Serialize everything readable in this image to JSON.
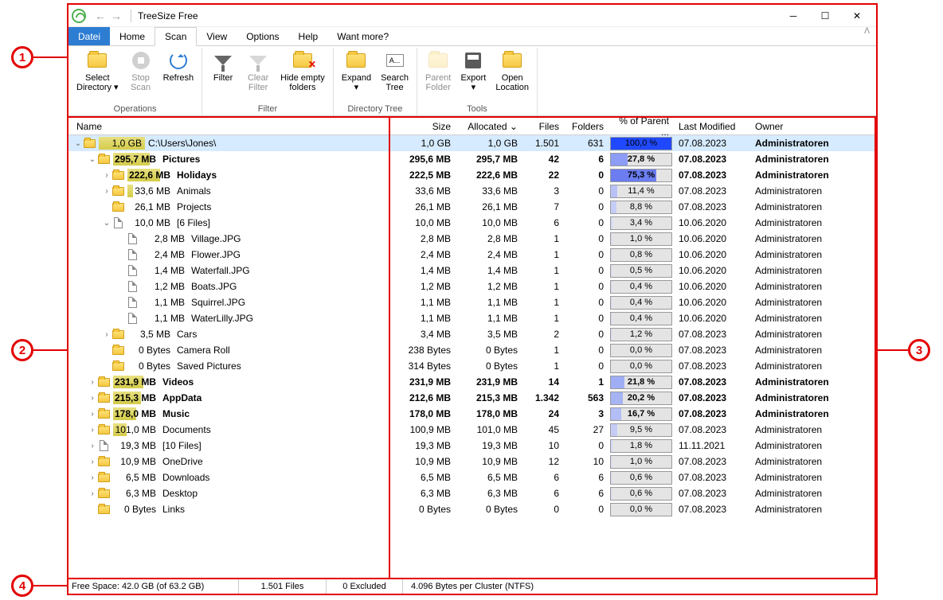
{
  "window": {
    "title": "TreeSize Free"
  },
  "menu": {
    "file": "Datei",
    "home": "Home",
    "scan": "Scan",
    "view": "View",
    "options": "Options",
    "help": "Help",
    "more": "Want more?"
  },
  "ribbon": {
    "select_dir": "Select\nDirectory ▾",
    "stop": "Stop\nScan",
    "refresh": "Refresh",
    "filter": "Filter",
    "clear_filter": "Clear\nFilter",
    "hide_empty": "Hide empty\nfolders",
    "expand": "Expand\n▾",
    "search": "Search\nTree",
    "parent": "Parent\nFolder",
    "export": "Export\n▾",
    "open_loc": "Open\nLocation",
    "grp_ops": "Operations",
    "grp_filter": "Filter",
    "grp_tree": "Directory Tree",
    "grp_tools": "Tools",
    "search_badge": "A..."
  },
  "columns": {
    "name": "Name",
    "size": "Size",
    "allocated": "Allocated ⌄",
    "files": "Files",
    "folders": "Folders",
    "percent": "% of Parent ...",
    "modified": "Last Modified",
    "owner": "Owner"
  },
  "rows": [
    {
      "depth": 0,
      "tw": "⌄",
      "icon": "folder",
      "size_label": "1,0 GB",
      "size_bar": 100,
      "name": "C:\\Users\\Jones\\",
      "bold": false,
      "selected": true,
      "size": "1,0 GB",
      "alloc": "1,0 GB",
      "files": "1.501",
      "folders": "631",
      "pct": "100,0 %",
      "pct_fill": 100,
      "pct_color": "#2049ff",
      "mod": "07.08.2023",
      "owner": "Administratoren",
      "owner_bold": true
    },
    {
      "depth": 1,
      "tw": "⌄",
      "icon": "folder",
      "size_label": "295,7 MB",
      "size_bar": 80,
      "name": "Pictures",
      "bold": true,
      "size": "295,6 MB",
      "alloc": "295,7 MB",
      "files": "42",
      "folders": "6",
      "pct": "27,8 %",
      "pct_fill": 28,
      "pct_color": "#8d9cf4",
      "mod": "07.08.2023",
      "owner": "Administratoren",
      "owner_bold": true
    },
    {
      "depth": 2,
      "tw": "›",
      "icon": "folder",
      "size_label": "222,6 MB",
      "size_bar": 70,
      "name": "Holidays",
      "bold": true,
      "size": "222,5 MB",
      "alloc": "222,6 MB",
      "files": "22",
      "folders": "0",
      "pct": "75,3 %",
      "pct_fill": 75,
      "pct_color": "#6b7df0",
      "mod": "07.08.2023",
      "owner": "Administratoren",
      "owner_bold": true
    },
    {
      "depth": 2,
      "tw": "›",
      "icon": "folder",
      "size_label": "33,6 MB",
      "size_bar": 12,
      "name": "Animals",
      "bold": false,
      "size": "33,6 MB",
      "alloc": "33,6 MB",
      "files": "3",
      "folders": "0",
      "pct": "11,4 %",
      "pct_fill": 11,
      "pct_color": "#b8c2f6",
      "mod": "07.08.2023",
      "owner": "Administratoren"
    },
    {
      "depth": 2,
      "tw": "",
      "icon": "folder",
      "size_label": "26,1 MB",
      "size_bar": 0,
      "name": "Projects",
      "bold": false,
      "size": "26,1 MB",
      "alloc": "26,1 MB",
      "files": "7",
      "folders": "0",
      "pct": "8,8 %",
      "pct_fill": 9,
      "pct_color": "#c5cdf6",
      "mod": "07.08.2023",
      "owner": "Administratoren"
    },
    {
      "depth": 2,
      "tw": "⌄",
      "icon": "file",
      "size_label": "10,0 MB",
      "size_bar": 0,
      "name": "[6 Files]",
      "bold": false,
      "size": "10,0 MB",
      "alloc": "10,0 MB",
      "files": "6",
      "folders": "0",
      "pct": "3,4 %",
      "pct_fill": 3,
      "pct_color": "#d4d9f6",
      "mod": "10.06.2020",
      "owner": "Administratoren"
    },
    {
      "depth": 3,
      "tw": "",
      "icon": "file",
      "size_label": "2,8 MB",
      "size_bar": 0,
      "name": "Village.JPG",
      "bold": false,
      "size": "2,8 MB",
      "alloc": "2,8 MB",
      "files": "1",
      "folders": "0",
      "pct": "1,0 %",
      "pct_fill": 1,
      "pct_color": "#d4d9f6",
      "mod": "10.06.2020",
      "owner": "Administratoren"
    },
    {
      "depth": 3,
      "tw": "",
      "icon": "file",
      "size_label": "2,4 MB",
      "size_bar": 0,
      "name": "Flower.JPG",
      "bold": false,
      "size": "2,4 MB",
      "alloc": "2,4 MB",
      "files": "1",
      "folders": "0",
      "pct": "0,8 %",
      "pct_fill": 1,
      "pct_color": "#d4d9f6",
      "mod": "10.06.2020",
      "owner": "Administratoren"
    },
    {
      "depth": 3,
      "tw": "",
      "icon": "file",
      "size_label": "1,4 MB",
      "size_bar": 0,
      "name": "Waterfall.JPG",
      "bold": false,
      "size": "1,4 MB",
      "alloc": "1,4 MB",
      "files": "1",
      "folders": "0",
      "pct": "0,5 %",
      "pct_fill": 1,
      "pct_color": "#d4d9f6",
      "mod": "10.06.2020",
      "owner": "Administratoren"
    },
    {
      "depth": 3,
      "tw": "",
      "icon": "file",
      "size_label": "1,2 MB",
      "size_bar": 0,
      "name": "Boats.JPG",
      "bold": false,
      "size": "1,2 MB",
      "alloc": "1,2 MB",
      "files": "1",
      "folders": "0",
      "pct": "0,4 %",
      "pct_fill": 1,
      "pct_color": "#d4d9f6",
      "mod": "10.06.2020",
      "owner": "Administratoren"
    },
    {
      "depth": 3,
      "tw": "",
      "icon": "file",
      "size_label": "1,1 MB",
      "size_bar": 0,
      "name": "Squirrel.JPG",
      "bold": false,
      "size": "1,1 MB",
      "alloc": "1,1 MB",
      "files": "1",
      "folders": "0",
      "pct": "0,4 %",
      "pct_fill": 1,
      "pct_color": "#d4d9f6",
      "mod": "10.06.2020",
      "owner": "Administratoren"
    },
    {
      "depth": 3,
      "tw": "",
      "icon": "file",
      "size_label": "1,1 MB",
      "size_bar": 0,
      "name": "WaterLilly.JPG",
      "bold": false,
      "size": "1,1 MB",
      "alloc": "1,1 MB",
      "files": "1",
      "folders": "0",
      "pct": "0,4 %",
      "pct_fill": 1,
      "pct_color": "#d4d9f6",
      "mod": "10.06.2020",
      "owner": "Administratoren"
    },
    {
      "depth": 2,
      "tw": "›",
      "icon": "folder",
      "size_label": "3,5 MB",
      "size_bar": 0,
      "name": "Cars",
      "bold": false,
      "size": "3,4 MB",
      "alloc": "3,5 MB",
      "files": "2",
      "folders": "0",
      "pct": "1,2 %",
      "pct_fill": 1,
      "pct_color": "#d4d9f6",
      "mod": "07.08.2023",
      "owner": "Administratoren"
    },
    {
      "depth": 2,
      "tw": "",
      "icon": "folder",
      "size_label": "0 Bytes",
      "size_bar": 0,
      "name": "Camera Roll",
      "bold": false,
      "size": "238 Bytes",
      "alloc": "0 Bytes",
      "files": "1",
      "folders": "0",
      "pct": "0,0 %",
      "pct_fill": 0,
      "pct_color": "#d4d9f6",
      "mod": "07.08.2023",
      "owner": "Administratoren"
    },
    {
      "depth": 2,
      "tw": "",
      "icon": "folder",
      "size_label": "0 Bytes",
      "size_bar": 0,
      "name": "Saved Pictures",
      "bold": false,
      "size": "314 Bytes",
      "alloc": "0 Bytes",
      "files": "1",
      "folders": "0",
      "pct": "0,0 %",
      "pct_fill": 0,
      "pct_color": "#d4d9f6",
      "mod": "07.08.2023",
      "owner": "Administratoren"
    },
    {
      "depth": 1,
      "tw": "›",
      "icon": "folder",
      "size_label": "231,9 MB",
      "size_bar": 65,
      "name": "Videos",
      "bold": true,
      "size": "231,9 MB",
      "alloc": "231,9 MB",
      "files": "14",
      "folders": "1",
      "pct": "21,8 %",
      "pct_fill": 22,
      "pct_color": "#9faef4",
      "mod": "07.08.2023",
      "owner": "Administratoren",
      "owner_bold": true
    },
    {
      "depth": 1,
      "tw": "›",
      "icon": "folder",
      "size_label": "215,3 MB",
      "size_bar": 60,
      "name": "AppData",
      "bold": true,
      "size": "212,6 MB",
      "alloc": "215,3 MB",
      "files": "1.342",
      "folders": "563",
      "pct": "20,2 %",
      "pct_fill": 20,
      "pct_color": "#a6b4f4",
      "mod": "07.08.2023",
      "owner": "Administratoren",
      "owner_bold": true
    },
    {
      "depth": 1,
      "tw": "›",
      "icon": "folder",
      "size_label": "178,0 MB",
      "size_bar": 50,
      "name": "Music",
      "bold": true,
      "size": "178,0 MB",
      "alloc": "178,0 MB",
      "files": "24",
      "folders": "3",
      "pct": "16,7 %",
      "pct_fill": 17,
      "pct_color": "#b2bef5",
      "mod": "07.08.2023",
      "owner": "Administratoren",
      "owner_bold": true
    },
    {
      "depth": 1,
      "tw": "›",
      "icon": "folder",
      "size_label": "101,0 MB",
      "size_bar": 30,
      "name": "Documents",
      "bold": false,
      "size": "100,9 MB",
      "alloc": "101,0 MB",
      "files": "45",
      "folders": "27",
      "pct": "9,5 %",
      "pct_fill": 10,
      "pct_color": "#c5cdf6",
      "mod": "07.08.2023",
      "owner": "Administratoren"
    },
    {
      "depth": 1,
      "tw": "›",
      "icon": "file",
      "size_label": "19,3 MB",
      "size_bar": 0,
      "name": "[10 Files]",
      "bold": false,
      "size": "19,3 MB",
      "alloc": "19,3 MB",
      "files": "10",
      "folders": "0",
      "pct": "1,8 %",
      "pct_fill": 2,
      "pct_color": "#d4d9f6",
      "mod": "11.11.2021",
      "owner": "Administratoren"
    },
    {
      "depth": 1,
      "tw": "›",
      "icon": "folder",
      "size_label": "10,9 MB",
      "size_bar": 0,
      "name": "OneDrive",
      "bold": false,
      "size": "10,9 MB",
      "alloc": "10,9 MB",
      "files": "12",
      "folders": "10",
      "pct": "1,0 %",
      "pct_fill": 1,
      "pct_color": "#d4d9f6",
      "mod": "07.08.2023",
      "owner": "Administratoren"
    },
    {
      "depth": 1,
      "tw": "›",
      "icon": "folder",
      "size_label": "6,5 MB",
      "size_bar": 0,
      "name": "Downloads",
      "bold": false,
      "size": "6,5 MB",
      "alloc": "6,5 MB",
      "files": "6",
      "folders": "6",
      "pct": "0,6 %",
      "pct_fill": 1,
      "pct_color": "#d4d9f6",
      "mod": "07.08.2023",
      "owner": "Administratoren"
    },
    {
      "depth": 1,
      "tw": "›",
      "icon": "folder",
      "size_label": "6,3 MB",
      "size_bar": 0,
      "name": "Desktop",
      "bold": false,
      "size": "6,3 MB",
      "alloc": "6,3 MB",
      "files": "6",
      "folders": "6",
      "pct": "0,6 %",
      "pct_fill": 1,
      "pct_color": "#d4d9f6",
      "mod": "07.08.2023",
      "owner": "Administratoren"
    },
    {
      "depth": 1,
      "tw": "",
      "icon": "folder",
      "size_label": "0 Bytes",
      "size_bar": 0,
      "name": "Links",
      "bold": false,
      "size": "0 Bytes",
      "alloc": "0 Bytes",
      "files": "0",
      "folders": "0",
      "pct": "0,0 %",
      "pct_fill": 0,
      "pct_color": "#d4d9f6",
      "mod": "07.08.2023",
      "owner": "Administratoren"
    }
  ],
  "status": {
    "free": "Free Space: 42.0 GB  (of 63.2 GB)",
    "files": "1.501 Files",
    "excluded": "0 Excluded",
    "cluster": "4.096 Bytes per Cluster (NTFS)"
  },
  "callouts": {
    "c1": "1",
    "c2": "2",
    "c3": "3",
    "c4": "4"
  }
}
